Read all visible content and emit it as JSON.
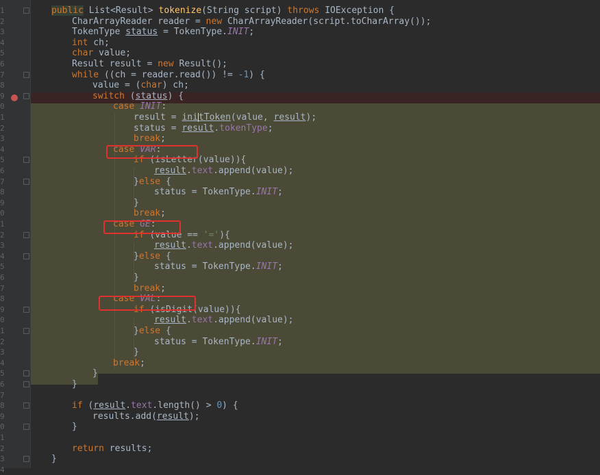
{
  "editor": {
    "line_numbers": [
      "1",
      "2",
      "3",
      "4",
      "5",
      "6",
      "7",
      "8",
      "9",
      "0",
      "1",
      "2",
      "3",
      "4",
      "5",
      "6",
      "7",
      "8",
      "9",
      "0",
      "1",
      "2",
      "3",
      "4",
      "5",
      "6",
      "7",
      "8",
      "9",
      "0",
      "1",
      "2",
      "3",
      "4",
      "5",
      "6",
      "7",
      "8",
      "9",
      "0",
      "1",
      "2",
      "3",
      "4"
    ],
    "breakpoint_line": "9",
    "colors": {
      "background": "#2b2b2b",
      "keyword": "#cc7832",
      "field": "#9876aa",
      "number": "#6897bb",
      "string": "#6a8759",
      "function": "#ffc66d",
      "highlight": "#4b4a37",
      "annotation_box": "#e0312f",
      "breakpoint": "#c75450"
    }
  },
  "code": {
    "l1": {
      "kw_public": "public",
      "rest1": " List<Result> ",
      "fn": "tokenize",
      "rest2": "(String script) ",
      "kw_throws": "throws",
      "rest3": " IOException {"
    },
    "l2": {
      "a": "CharArrayReader reader = ",
      "kw_new": "new",
      "b": " CharArrayReader(script.toCharArray());"
    },
    "l3": {
      "a": "TokenType ",
      "b": "status",
      " c": " = TokenType.",
      "it": "INIT",
      "d": ";"
    },
    "l4": {
      "kw": "int",
      "a": " ch;"
    },
    "l5": {
      "kw": "char",
      "a": " value;"
    },
    "l6": {
      "a": "Result result = ",
      "kw": "new",
      "b": " Result();"
    },
    "l7": {
      "kw": "while",
      "a": " ((ch = reader.read()) != ",
      "num": "-1",
      "b": ") {"
    },
    "l8": {
      "a": "value = (",
      "kw": "char",
      "b": ") ch;"
    },
    "l9": {
      "kw": "switch",
      "a": " (",
      "b": "status",
      "c": ") {"
    },
    "l10": {
      "kw": "case",
      "it": "INIT",
      "a": ":"
    },
    "l11": {
      "a": "result = ",
      "b": "ini",
      "c": "tToken",
      "d": "(value, ",
      "e": "result",
      "f": ");"
    },
    "l12": {
      "a": "status",
      "b": " = ",
      "c": "result",
      "d": ".",
      "fld": "tokenType",
      "e": ";"
    },
    "l13": {
      "kw": "break",
      "a": ";"
    },
    "l14": {
      "kw": "case",
      "it": "VAR",
      "a": ":"
    },
    "l15": {
      "kw": "if",
      "a": " (isLetter(value)){"
    },
    "l16": {
      "a": "result",
      "b": ".",
      "fld": "text",
      "c": ".append(value);"
    },
    "l17": {
      "a": "}",
      "kw": "else",
      "b": " {"
    },
    "l18": {
      "a": "status = TokenType.",
      "it": "INIT",
      "b": ";"
    },
    "l19": {
      "a": "}"
    },
    "l20": {
      "kw": "break",
      "a": ";"
    },
    "l21": {
      "kw": "case",
      "it": "GE",
      "a": ":"
    },
    "l22": {
      "kw": "if",
      "a": " (value == ",
      "str": "'='",
      "b": "){"
    },
    "l23": {
      "a": "result",
      "b": ".",
      "fld": "text",
      "c": ".append(value);"
    },
    "l24": {
      "a": "}",
      "kw": "else",
      "b": " {"
    },
    "l25": {
      "a": "status = TokenType.",
      "it": "INIT",
      "b": ";"
    },
    "l26": {
      "a": "}"
    },
    "l27": {
      "kw": "break",
      "a": ";"
    },
    "l28": {
      "kw": "case",
      "it": "VAL",
      "a": ":"
    },
    "l29": {
      "kw": "if",
      "a": " (isDigit(value)){"
    },
    "l30": {
      "a": "result",
      "b": ".",
      "fld": "text",
      "c": ".append(value);"
    },
    "l31": {
      "a": "}",
      "kw": "else",
      "b": " {"
    },
    "l32": {
      "a": "status = TokenType.",
      "it": "INIT",
      "b": ";"
    },
    "l33": {
      "a": "}"
    },
    "l34": {
      "kw": "break",
      "a": ";"
    },
    "l35": {
      "a": "}"
    },
    "l36": {
      "a": "}"
    },
    "l38": {
      "kw": "if",
      "a": " (",
      "b": "result",
      "c": ".",
      "fld": "text",
      "d": ".length() > ",
      "num": "0",
      "e": ") {"
    },
    "l39": {
      "a": "results.add(",
      "b": "result",
      "c": ");"
    },
    "l40": {
      "a": "}"
    },
    "l42": {
      "kw": "return",
      "a": " results;"
    },
    "l43": {
      "a": "}"
    }
  }
}
